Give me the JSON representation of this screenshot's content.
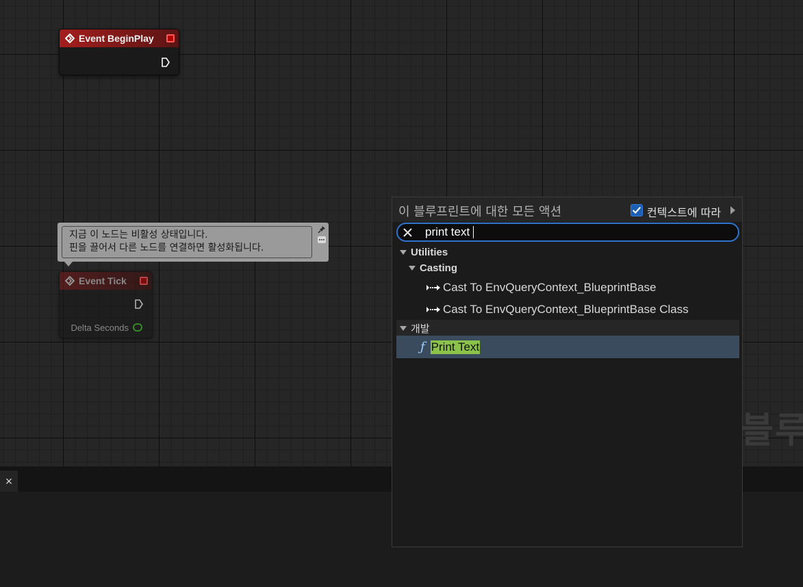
{
  "graph": {
    "nodes": {
      "begin_play": {
        "title": "Event BeginPlay"
      },
      "event_tick": {
        "title": "Event Tick",
        "pin_label": "Delta Seconds"
      }
    },
    "comment": {
      "line1": "지금 이 노드는 비활성 상태입니다.",
      "line2": "핀을 끌어서 다른 노드를 연결하면 활성화됩니다."
    },
    "watermark": "블루프"
  },
  "bottom_panel": {
    "tab_close": "×"
  },
  "palette": {
    "title": "이 블루프린트에 대한 모든 액션",
    "context_label": "컨텍스트에 따라",
    "context_checked": true,
    "search_value": "print text",
    "results": {
      "utilities": "Utilities",
      "casting": "Casting",
      "cast1": "Cast To EnvQueryContext_BlueprintBase",
      "cast2": "Cast To EnvQueryContext_BlueprintBase Class",
      "dev": "개발",
      "print": "Print Text"
    }
  },
  "colors": {
    "accent": "#2d74d0",
    "selection": "#3b4b5e",
    "highlight": "#8bc34a",
    "event_red": "#a51e1e"
  }
}
